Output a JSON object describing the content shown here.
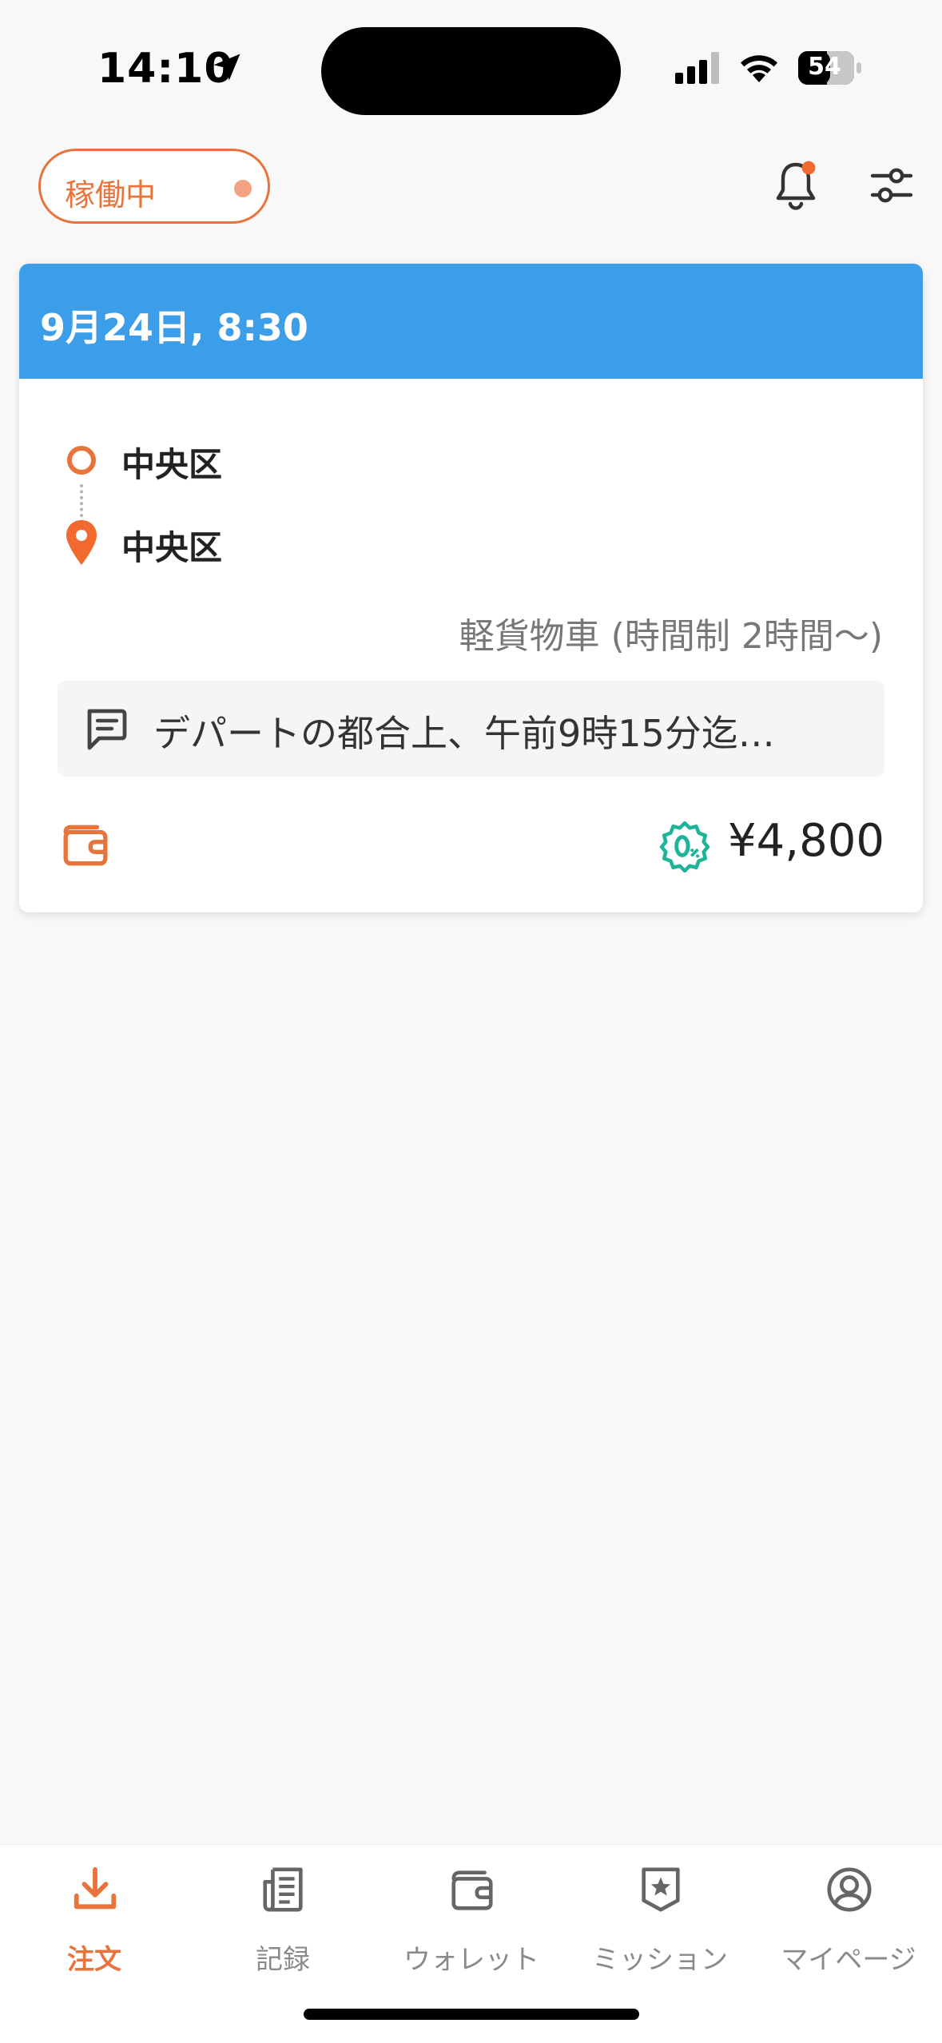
{
  "status_bar": {
    "time": "14:10",
    "battery": "54"
  },
  "header": {
    "status_label": "稼働中"
  },
  "order_card": {
    "datetime": "9月24日, 8:30",
    "origin": "中央区",
    "destination": "中央区",
    "vehicle": "軽貨物車 (時間制 2時間〜)",
    "note": "デパートの都合上、午前9時15分迄…",
    "price": "¥4,800"
  },
  "tabs": [
    {
      "label": "注文",
      "icon": "download-icon",
      "active": true
    },
    {
      "label": "記録",
      "icon": "document-icon",
      "active": false
    },
    {
      "label": "ウォレット",
      "icon": "wallet-icon",
      "active": false
    },
    {
      "label": "ミッション",
      "icon": "star-badge-icon",
      "active": false
    },
    {
      "label": "マイページ",
      "icon": "user-circle-icon",
      "active": false
    }
  ],
  "colors": {
    "accent": "#e8743b",
    "card_header": "#3c9de8",
    "promo": "#1fb39a"
  }
}
